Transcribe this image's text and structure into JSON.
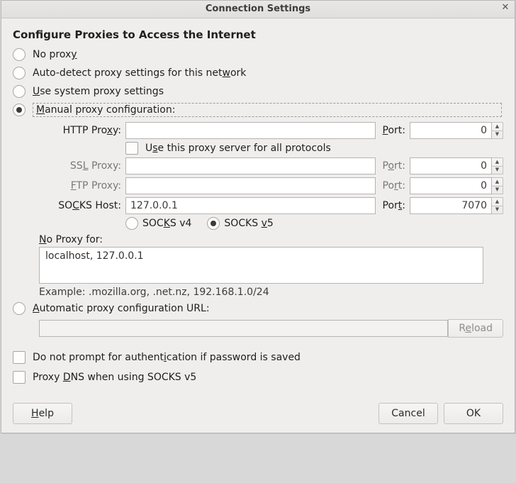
{
  "window": {
    "title": "Connection Settings"
  },
  "heading": "Configure Proxies to Access the Internet",
  "radios": {
    "no_proxy": "No prox",
    "no_proxy_accel": "y",
    "auto_detect_pre": "Auto-detect proxy settings for this net",
    "auto_detect_accel": "w",
    "auto_detect_post": "ork",
    "system_pre": "U",
    "system_post": "se system proxy settings",
    "manual_pre": "",
    "manual_accel": "M",
    "manual_post": "anual proxy configuration:",
    "auto_url_pre": "",
    "auto_url_accel": "A",
    "auto_url_post": "utomatic proxy configuration URL:"
  },
  "rows": {
    "http": {
      "label_pre": "HTTP Pro",
      "label_acc": "x",
      "label_post": "y:",
      "portlabel_pre": "",
      "portlabel_acc": "P",
      "portlabel_post": "ort:",
      "port": "0"
    },
    "useall": {
      "pre": "U",
      "acc": "s",
      "post": "e this proxy server for all protocols"
    },
    "ssl": {
      "label_pre": "SS",
      "label_acc": "L",
      "label_post": " Proxy:",
      "portlabel_pre": "P",
      "portlabel_acc": "o",
      "portlabel_post": "rt:",
      "port": "0"
    },
    "ftp": {
      "label_pre": "",
      "label_acc": "F",
      "label_post": "TP Proxy:",
      "portlabel_pre": "Po",
      "portlabel_acc": "r",
      "portlabel_post": "t:",
      "port": "0"
    },
    "socks": {
      "label_pre": "SO",
      "label_acc": "C",
      "label_post": "KS Host:",
      "host": "127.0.0.1",
      "portlabel_pre": "Por",
      "portlabel_acc": "t",
      "portlabel_post": ":",
      "port": "7070"
    },
    "socksv4": {
      "pre": "SOC",
      "acc": "K",
      "post": "S v4"
    },
    "socksv5": {
      "pre": "SOCKS ",
      "acc": "v",
      "post": "5"
    }
  },
  "noproxy": {
    "label_pre": "",
    "label_acc": "N",
    "label_post": "o Proxy for:",
    "value": "localhost, 127.0.0.1",
    "example": "Example: .mozilla.org, .net.nz, 192.168.1.0/24"
  },
  "reload": {
    "pre": "R",
    "acc": "e",
    "post": "load"
  },
  "opts": {
    "noprompt": {
      "pre": "Do not prompt for authent",
      "acc": "i",
      "post": "cation if password is saved"
    },
    "proxydns": {
      "pre": "Proxy ",
      "acc": "D",
      "post": "NS when using SOCKS v5"
    }
  },
  "buttons": {
    "help_pre": "",
    "help_acc": "H",
    "help_post": "elp",
    "cancel": "Cancel",
    "ok": "OK"
  }
}
